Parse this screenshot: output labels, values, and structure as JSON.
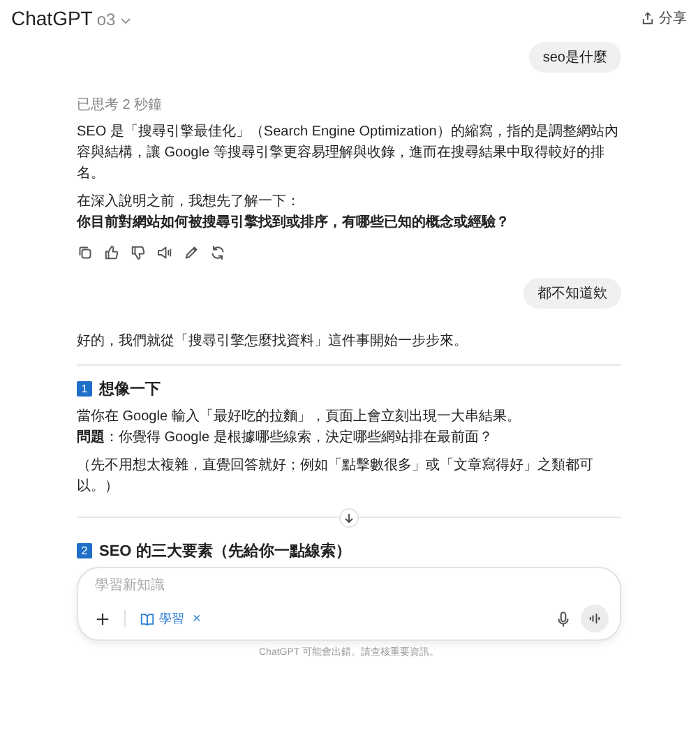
{
  "header": {
    "app": "ChatGPT",
    "model": "o3",
    "share": "分享"
  },
  "turn_1": {
    "user": "seo是什麼",
    "thought": "已思考 2 秒鐘",
    "paragraph": "SEO 是「搜尋引擎最佳化」（Search Engine Optimization）的縮寫，指的是調整網站內容與結構，讓 Google 等搜尋引擎更容易理解與收錄，進而在搜尋結果中取得較好的排名。",
    "intro": "在深入說明之前，我想先了解一下：",
    "question": "你目前對網站如何被搜尋引擎找到或排序，有哪些已知的概念或經驗？"
  },
  "turn_2": {
    "user": "都不知道欸",
    "opening": "好的，我們就從「搜尋引擎怎麼找資料」這件事開始一步步來。",
    "sections": [
      {
        "number": "1",
        "title": "想像一下",
        "paragraphs": [
          "當你在 Google 輸入「最好吃的拉麵」，頁面上會立刻出現一大串結果。",
          "**問題**：你覺得 Google 是根據哪些線索，決定哪些網站排在最前面？",
          "（先不用想太複雜，直覺回答就好；例如「點擊數很多」或「文章寫得好」之類都可以。）"
        ]
      },
      {
        "number": "2",
        "title": "SEO 的三大要素（先給你一點線索）"
      }
    ]
  },
  "composer": {
    "placeholder": "學習新知識",
    "chip": "學習",
    "chip_close": "×"
  },
  "footer": "ChatGPT 可能會出錯。請查核重要資訊。"
}
